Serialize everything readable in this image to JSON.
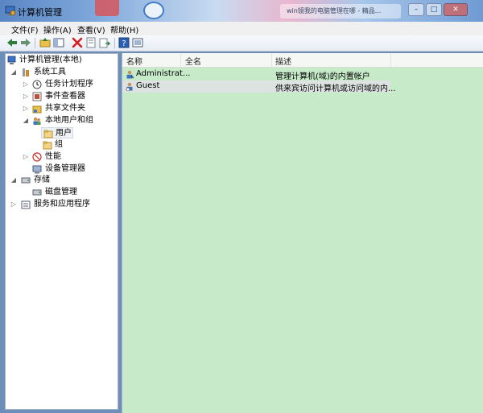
{
  "window": {
    "title": "计算机管理",
    "background_window_title": "win镜我的电脑管理在哪 - 精品..."
  },
  "menu": [
    "文件(F)",
    "操作(A)",
    "查看(V)",
    "帮助(H)"
  ],
  "toolbar": {
    "icons": [
      "back-arrow-icon",
      "forward-arrow-icon",
      "up-folder-icon",
      "console-tree-icon",
      "delete-icon",
      "properties-icon",
      "export-icon",
      "help-icon",
      "view-icon"
    ]
  },
  "tree": {
    "root": "计算机管理(本地)",
    "system_tools": "系统工具",
    "task_scheduler": "任务计划程序",
    "event_viewer": "事件查看器",
    "shared_folders": "共享文件夹",
    "local_users_groups": "本地用户和组",
    "users": "用户",
    "groups": "组",
    "performance": "性能",
    "device_manager": "设备管理器",
    "storage": "存储",
    "disk_management": "磁盘管理",
    "services_apps": "服务和应用程序"
  },
  "list": {
    "columns": [
      "名称",
      "全名",
      "描述"
    ],
    "rows": [
      {
        "name": "Administrat...",
        "fullname": "",
        "desc": "管理计算机(域)的内置帐户"
      },
      {
        "name": "Guest",
        "fullname": "",
        "desc": "供来宾访问计算机或访问域的内..."
      }
    ]
  },
  "colors": {
    "list_background": "#c7ebc9",
    "selection": "#dde3e0"
  }
}
